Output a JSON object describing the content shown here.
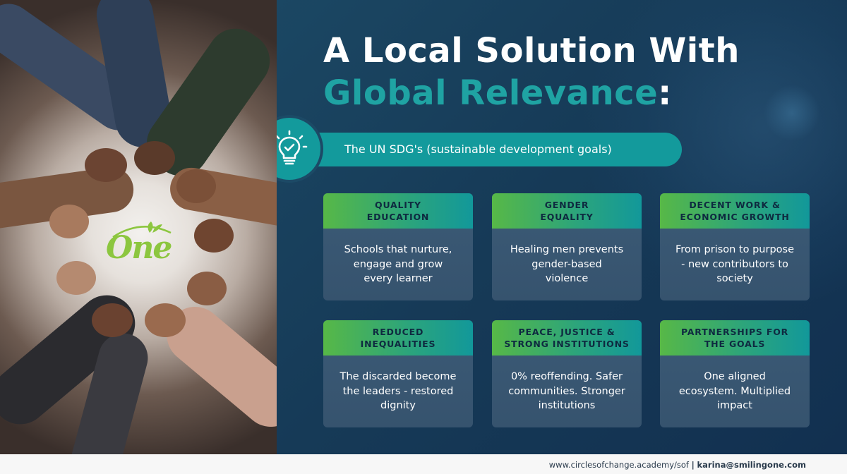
{
  "title": {
    "line1": "A Local Solution With",
    "line2": "Global Relevance",
    "line2_suffix": ":"
  },
  "banner": {
    "icon": "lightbulb-check-icon",
    "text": "The UN SDG's (sustainable development goals)"
  },
  "logo": {
    "text": "One",
    "icon": "leaf-sprout-icon"
  },
  "cards": [
    {
      "heading": "QUALITY\nEDUCATION",
      "body": "Schools that nurture,\nengage and grow\nevery learner"
    },
    {
      "heading": "GENDER\nEQUALITY",
      "body": "Healing men prevents\ngender-based\nviolence"
    },
    {
      "heading": "DECENT WORK &\nECONOMIC GROWTH",
      "body": "From prison to purpose\n- new contributors to\nsociety"
    },
    {
      "heading": "REDUCED\nINEQUALITIES",
      "body": "The discarded become\nthe leaders - restored\ndignity"
    },
    {
      "heading": "PEACE, JUSTICE &\nSTRONG INSTITUTIONS",
      "body": "0% reoffending. Safer\ncommunities. Stronger\ninstitutions"
    },
    {
      "heading": "PARTNERSHIPS FOR\nTHE GOALS",
      "body": "One aligned\necosystem. Multiplied\nimpact"
    }
  ],
  "footer": {
    "url": "www.circlesofchange.academy/sof",
    "separator": "|",
    "email": "karina@smilingone.com"
  },
  "colors": {
    "panel_bg": "#163a57",
    "accent_teal": "#1fa3a3",
    "accent_green": "#57b847",
    "logo_green": "#8cc63f"
  }
}
